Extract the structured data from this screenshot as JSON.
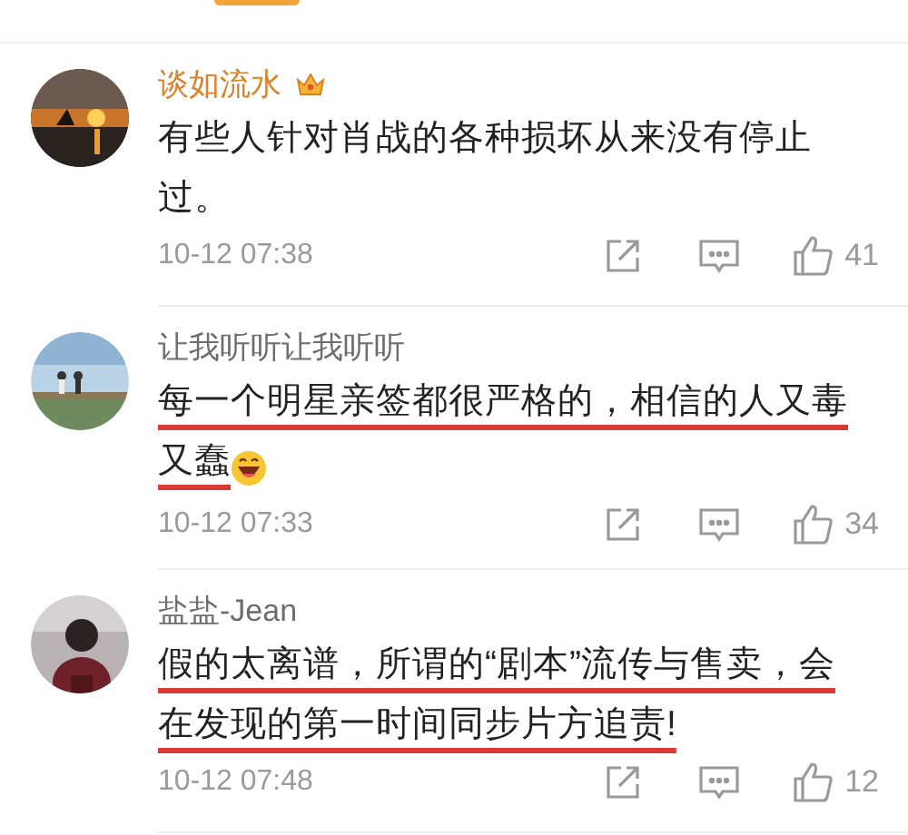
{
  "comments": [
    {
      "user": "谈如流水",
      "user_highlighted": true,
      "crown_badge": true,
      "lines": [
        "有些人针对肖战的各种损坏从来没有停止",
        "过。"
      ],
      "emoji": false,
      "underlined": false,
      "time": "10-12 07:38",
      "likes": "41"
    },
    {
      "user": "让我听听让我听听",
      "user_highlighted": false,
      "crown_badge": false,
      "lines": [
        "每一个明星亲签都很严格的，相信的人又毒",
        "又蠢"
      ],
      "emoji": true,
      "underlined": true,
      "time": "10-12 07:33",
      "likes": "34"
    },
    {
      "user": "盐盐-Jean",
      "user_highlighted": false,
      "crown_badge": false,
      "lines": [
        "假的太离谱，所谓的“剧本”流传与售卖，会",
        "在发现的第一时间同步片方追责!"
      ],
      "emoji": false,
      "underlined": true,
      "time": "10-12 07:48",
      "likes": "12"
    }
  ]
}
